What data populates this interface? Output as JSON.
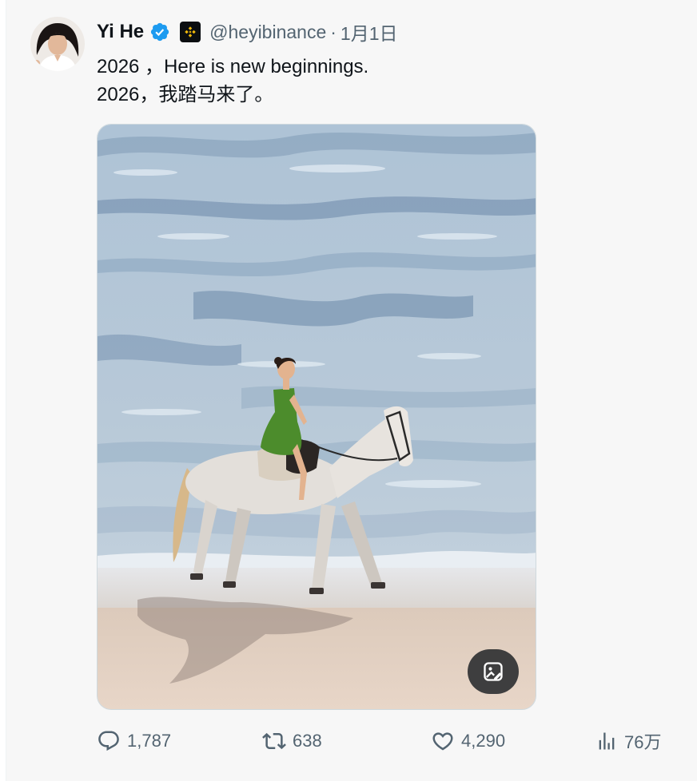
{
  "author": {
    "name": "Yi He",
    "handle": "@heyibinance",
    "separator": "·",
    "date": "1月1日",
    "verified_badge_icon": "verified-badge-icon",
    "affiliation_icon": "binance-logo-icon",
    "colors": {
      "verified": "#1d9bf0",
      "affiliation_bg": "#0b0e11",
      "affiliation_logo": "#f0b90b"
    }
  },
  "tweet": {
    "lines": [
      "2026 ，Here is new beginnings.",
      "2026，我踏马来了。"
    ]
  },
  "media": {
    "alt_icon": "image-description-icon"
  },
  "actions": {
    "reply": {
      "icon": "reply-icon",
      "count": "1,787"
    },
    "retweet": {
      "icon": "retweet-icon",
      "count": "638"
    },
    "like": {
      "icon": "heart-icon",
      "count": "4,290"
    },
    "views": {
      "icon": "views-icon",
      "count": "76万"
    }
  },
  "colors": {
    "text": "#0f1419",
    "secondary": "#536471",
    "background": "#f7f7f7"
  }
}
